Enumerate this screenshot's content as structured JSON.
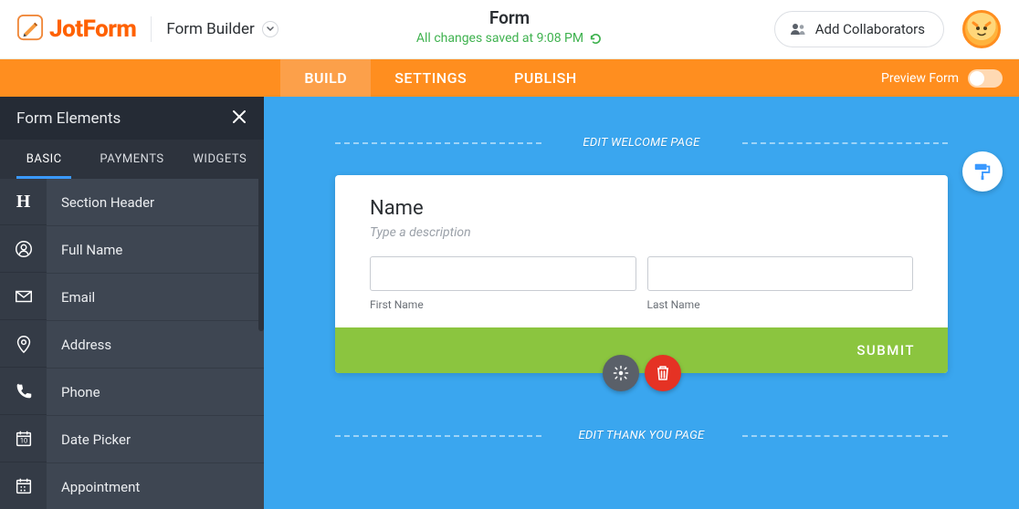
{
  "brand": {
    "name": "JotForm"
  },
  "header": {
    "mode_label": "Form Builder",
    "form_title": "Form",
    "save_status": "All changes saved at 9:08 PM",
    "collab_label": "Add Collaborators"
  },
  "main_tabs": [
    {
      "label": "BUILD",
      "active": true
    },
    {
      "label": "SETTINGS",
      "active": false
    },
    {
      "label": "PUBLISH",
      "active": false
    }
  ],
  "preview_label": "Preview Form",
  "sidebar": {
    "title": "Form Elements",
    "tabs": [
      {
        "label": "BASIC",
        "active": true
      },
      {
        "label": "PAYMENTS",
        "active": false
      },
      {
        "label": "WIDGETS",
        "active": false
      }
    ],
    "elements": [
      {
        "icon": "heading-icon",
        "label": "Section Header"
      },
      {
        "icon": "user-icon",
        "label": "Full Name"
      },
      {
        "icon": "mail-icon",
        "label": "Email"
      },
      {
        "icon": "pin-icon",
        "label": "Address"
      },
      {
        "icon": "phone-icon",
        "label": "Phone"
      },
      {
        "icon": "calendar-icon",
        "label": "Date Picker"
      },
      {
        "icon": "appointment-icon",
        "label": "Appointment"
      }
    ]
  },
  "canvas": {
    "welcome_label": "EDIT WELCOME PAGE",
    "thank_label": "EDIT THANK YOU PAGE",
    "field": {
      "title": "Name",
      "description_placeholder": "Type a description",
      "first_label": "First Name",
      "last_label": "Last Name"
    },
    "submit_label": "SUBMIT"
  }
}
